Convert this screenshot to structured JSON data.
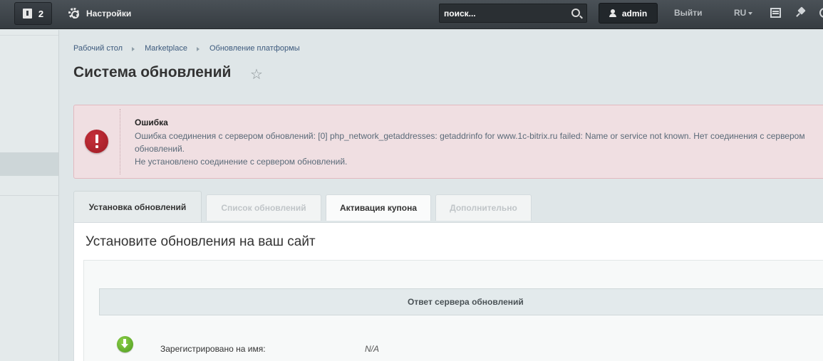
{
  "topbar": {
    "notifications_count": "2",
    "settings_label": "Настройки",
    "search_placeholder": "поиск...",
    "user_name": "admin",
    "logout_label": "Выйти",
    "language": "RU"
  },
  "breadcrumbs": [
    "Рабочий стол",
    "Marketplace",
    "Обновление платформы"
  ],
  "page": {
    "title": "Система обновлений"
  },
  "error": {
    "title": "Ошибка",
    "line1": "Ошибка соединения с сервером обновлений: [0] php_network_getaddresses: getaddrinfo for www.1c-bitrix.ru failed: Name or service not known. Нет соединения с сервером обновлений.",
    "line2": "Не установлено соединение с сервером обновлений."
  },
  "tabs": [
    {
      "label": "Установка обновлений",
      "state": "active"
    },
    {
      "label": "Список обновлений",
      "state": "disabled"
    },
    {
      "label": "Активация купона",
      "state": "normal"
    },
    {
      "label": "Дополнительно",
      "state": "disabled"
    }
  ],
  "content": {
    "heading": "Установите обновления на ваш сайт",
    "response_header": "Ответ сервера обновлений",
    "registered_label": "Зарегистрировано на имя:",
    "registered_value": "N/A"
  },
  "colors": {
    "topbar": "#3f454a",
    "error_bg": "#f0dfe2",
    "error_icon": "#b3232d",
    "ok_icon": "#6bb52f",
    "link": "#3d5a7d"
  }
}
